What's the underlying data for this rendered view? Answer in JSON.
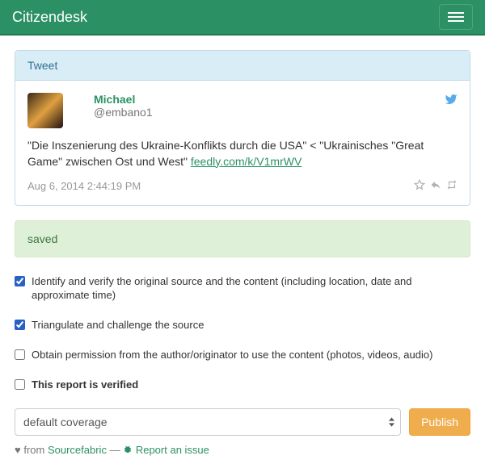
{
  "brand": "Citizendesk",
  "panel": {
    "heading": "Tweet"
  },
  "tweet": {
    "author_name": "Michael",
    "author_handle": "@embano1",
    "text_before_link": "\"Die Inszenierung des Ukraine-Konflikts durch die USA\" < \"Ukrainisches \"Great Game\" zwischen Ost und West\" ",
    "link_text": "feedly.com/k/V1mrWV",
    "timestamp": "Aug 6, 2014 2:44:19 PM"
  },
  "alert": "saved",
  "checks": {
    "identify": "Identify and verify the original source and the content (including location, date and approximate time)",
    "triangulate": "Triangulate and challenge the source",
    "permission": "Obtain permission from the author/originator to use the content (photos, videos, audio)",
    "verified": "This report is verified"
  },
  "coverage": {
    "selected": "default coverage"
  },
  "publish_label": "Publish",
  "footer": {
    "heart": "♥",
    "from": "from",
    "sourcefabric": "Sourcefabric",
    "dash": "—",
    "report_issue": "Report an issue"
  }
}
